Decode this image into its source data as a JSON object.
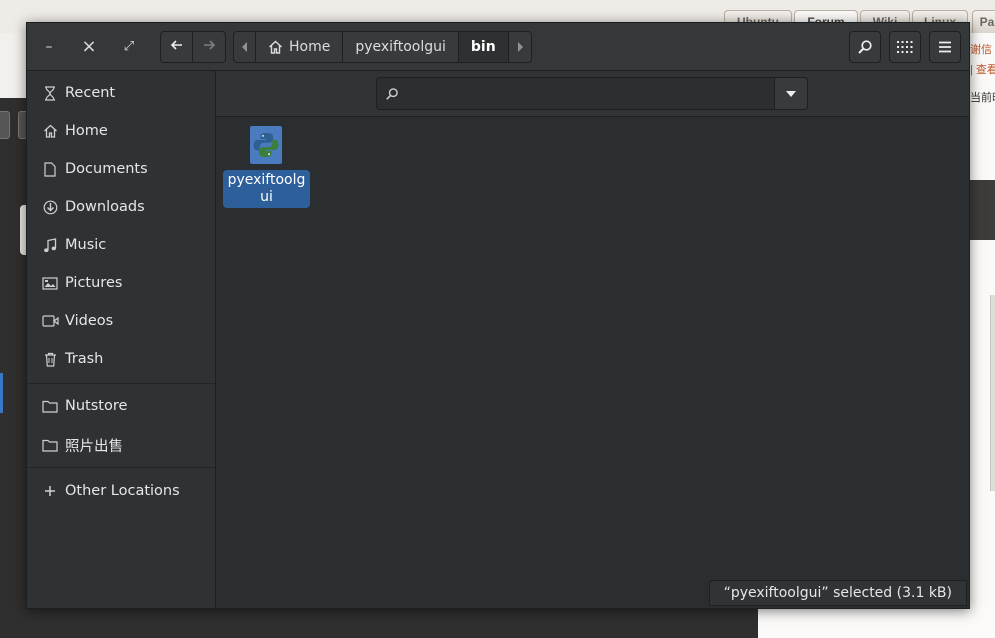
{
  "background": {
    "tabs": [
      "Ubuntu",
      "Forum",
      "Wiki",
      "Linux",
      "Pa"
    ],
    "right_text": [
      "谢信",
      "| 查看",
      "当前时"
    ]
  },
  "window": {
    "controls": {
      "minimize": "–",
      "close": "×",
      "maximize": "⤢"
    },
    "nav": {
      "back_icon": "arrow-left-icon",
      "forward_icon": "arrow-right-icon"
    },
    "breadcrumbs": {
      "items": [
        "Home",
        "pyexiftoolgui",
        "bin"
      ],
      "home_icon": "home-icon"
    },
    "toolbar": {
      "search_icon": "search-icon",
      "view_icon": "grid-view-icon",
      "menu_icon": "hamburger-menu-icon"
    }
  },
  "sidebar": {
    "places": [
      {
        "label": "Recent",
        "icon": "clock-icon"
      },
      {
        "label": "Home",
        "icon": "home-icon"
      },
      {
        "label": "Documents",
        "icon": "document-icon"
      },
      {
        "label": "Downloads",
        "icon": "download-icon"
      },
      {
        "label": "Music",
        "icon": "music-icon"
      },
      {
        "label": "Pictures",
        "icon": "pictures-icon"
      },
      {
        "label": "Videos",
        "icon": "video-icon"
      },
      {
        "label": "Trash",
        "icon": "trash-icon"
      }
    ],
    "bookmarks": [
      {
        "label": "Nutstore",
        "icon": "folder-icon"
      },
      {
        "label": "照片出售",
        "icon": "folder-icon"
      }
    ],
    "other": {
      "label": "Other Locations",
      "icon": "plus-icon"
    }
  },
  "search": {
    "value": "",
    "placeholder": ""
  },
  "files": [
    {
      "name_line1": "pyexiftoolg",
      "name_line2": "ui",
      "icon": "python-file-icon",
      "selected": true
    }
  ],
  "status": {
    "text": "“pyexiftoolgui” selected  (3.1 kB)"
  },
  "colors": {
    "accent": "#2d5f9a",
    "window_bg": "#2b2e30",
    "header_bg": "#353839"
  }
}
